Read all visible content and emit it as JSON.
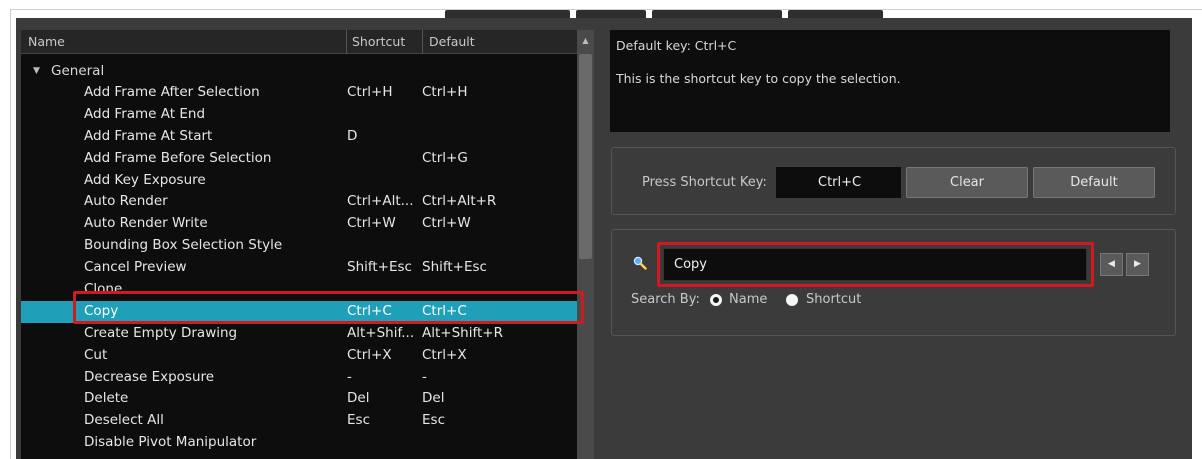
{
  "tree": {
    "columns": {
      "name": "Name",
      "shortcut": "Shortcut",
      "default": "Default"
    },
    "group": "General",
    "rows": [
      {
        "name": "Add Frame After Selection",
        "shortcut": "Ctrl+H",
        "default": "Ctrl+H"
      },
      {
        "name": "Add Frame At End",
        "shortcut": "",
        "default": ""
      },
      {
        "name": "Add Frame At Start",
        "shortcut": "D",
        "default": ""
      },
      {
        "name": "Add Frame Before Selection",
        "shortcut": "",
        "default": "Ctrl+G"
      },
      {
        "name": "Add Key Exposure",
        "shortcut": "",
        "default": ""
      },
      {
        "name": "Auto Render",
        "shortcut": "Ctrl+Alt...",
        "default": "Ctrl+Alt+R"
      },
      {
        "name": "Auto Render Write",
        "shortcut": "Ctrl+W",
        "default": "Ctrl+W"
      },
      {
        "name": "Bounding Box Selection Style",
        "shortcut": "",
        "default": ""
      },
      {
        "name": "Cancel Preview",
        "shortcut": "Shift+Esc",
        "default": "Shift+Esc"
      },
      {
        "name": "Clone",
        "shortcut": "",
        "default": ""
      },
      {
        "name": "Copy",
        "shortcut": "Ctrl+C",
        "default": "Ctrl+C",
        "selected": true
      },
      {
        "name": "Create Empty Drawing",
        "shortcut": "Alt+Shif...",
        "default": "Alt+Shift+R"
      },
      {
        "name": "Cut",
        "shortcut": "Ctrl+X",
        "default": "Ctrl+X"
      },
      {
        "name": "Decrease Exposure",
        "shortcut": "-",
        "default": "-"
      },
      {
        "name": "Delete",
        "shortcut": "Del",
        "default": "Del"
      },
      {
        "name": "Deselect All",
        "shortcut": "Esc",
        "default": "Esc"
      },
      {
        "name": "Disable Pivot Manipulator",
        "shortcut": "",
        "default": ""
      }
    ]
  },
  "description": {
    "default_key": "Default key: Ctrl+C",
    "text": "This is the shortcut key to copy the selection."
  },
  "shortcut_editor": {
    "label": "Press Shortcut Key:",
    "value": "Ctrl+C",
    "clear_label": "Clear",
    "default_label": "Default"
  },
  "search": {
    "value": "Copy",
    "prev_glyph": "◀",
    "next_glyph": "▶",
    "search_by_label": "Search By:",
    "option_name": "Name",
    "option_shortcut": "Shortcut",
    "selected_option": "Name"
  },
  "colors": {
    "selection": "#1fa0b8",
    "highlight": "#d01a20",
    "panel_bg": "#3b3b3b"
  }
}
